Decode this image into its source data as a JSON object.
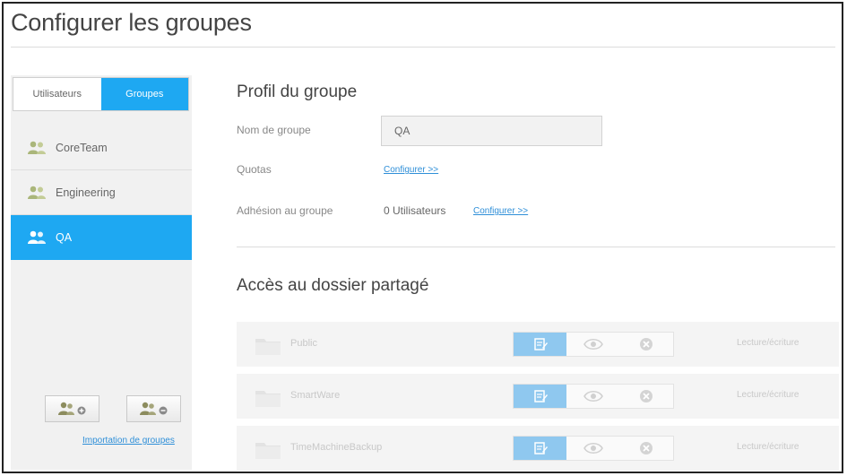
{
  "page": {
    "title": "Configurer les groupes"
  },
  "sidebar": {
    "tabs": [
      {
        "label": "Utilisateurs",
        "active": false
      },
      {
        "label": "Groupes",
        "active": true
      }
    ],
    "groups": [
      {
        "name": "CoreTeam",
        "selected": false,
        "icon": "group-icon"
      },
      {
        "name": "Engineering",
        "selected": false,
        "icon": "group-icon"
      },
      {
        "name": "QA",
        "selected": true,
        "icon": "group-icon"
      }
    ],
    "actions": [
      {
        "icon": "add-group-icon"
      },
      {
        "icon": "remove-group-icon"
      }
    ],
    "import_link": "Importation de groupes"
  },
  "profile": {
    "section_title": "Profil du groupe",
    "name_label": "Nom de groupe",
    "name_value": "QA",
    "quotas_label": "Quotas",
    "quotas_link": "Configurer >>",
    "membership_label": "Adhésion au groupe",
    "membership_value": "0 Utilisateurs",
    "membership_link": "Configurer >>"
  },
  "shares": {
    "section_title": "Accès au dossier partagé",
    "rows": [
      {
        "name": "Public",
        "access": "Lecture/écriture"
      },
      {
        "name": "SmartWare",
        "access": "Lecture/écriture"
      },
      {
        "name": "TimeMachineBackup",
        "access": "Lecture/écriture"
      }
    ],
    "icons": {
      "read_write": "edit-icon",
      "read_only": "eye-icon",
      "no_access": "deny-icon",
      "folder": "folder-icon"
    }
  },
  "colors": {
    "accent": "#1ea8f2",
    "accent_soft": "#8fc8ef",
    "link": "#2f8fd8"
  }
}
